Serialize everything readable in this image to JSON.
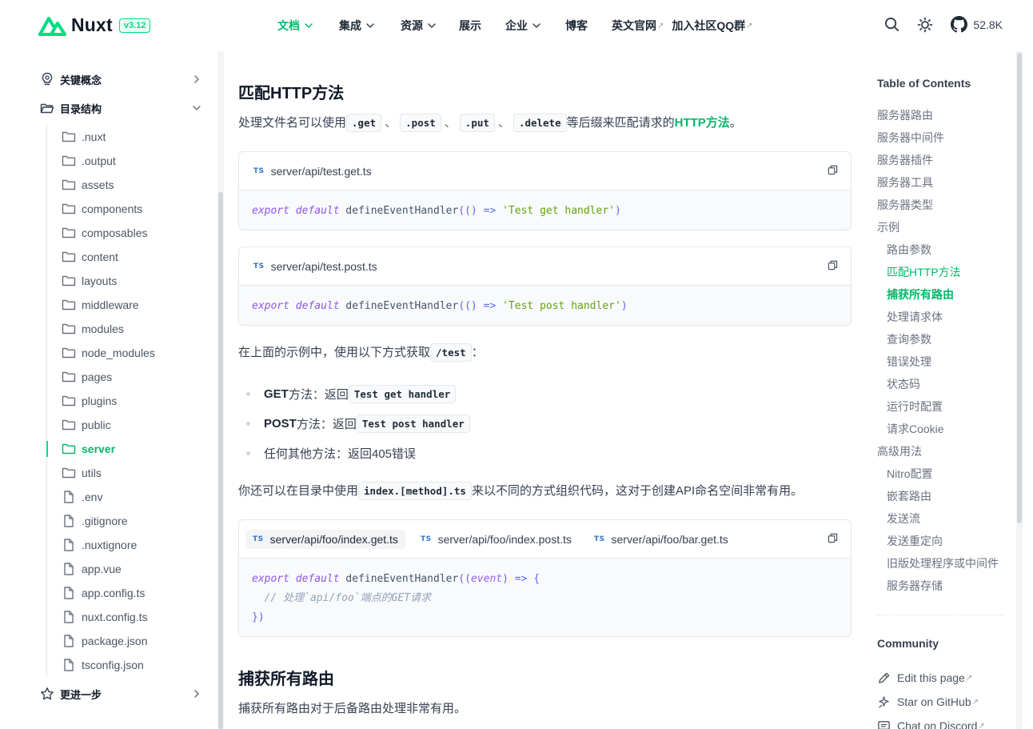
{
  "header": {
    "brand": "Nuxt",
    "version": "v3.12",
    "nav": [
      {
        "label": "文档",
        "dropdown": true,
        "active": true
      },
      {
        "label": "集成",
        "dropdown": true
      },
      {
        "label": "资源",
        "dropdown": true
      },
      {
        "label": "展示"
      },
      {
        "label": "企业",
        "dropdown": true
      },
      {
        "label": "博客"
      },
      {
        "label": "英文官网",
        "external": true
      },
      {
        "label": "加入社区QQ群",
        "external": true
      }
    ],
    "github_stars": "52.8K",
    "external_mark": "↗"
  },
  "sidebar": {
    "sections": [
      {
        "label": "关键概念",
        "icon": "lightbulb-icon",
        "expanded": false
      },
      {
        "label": "目录结构",
        "icon": "folder-open-icon",
        "expanded": true
      },
      {
        "label": "更进一步",
        "icon": "star-icon",
        "expanded": false
      }
    ],
    "tree": [
      {
        "label": ".nuxt",
        "type": "folder"
      },
      {
        "label": ".output",
        "type": "folder"
      },
      {
        "label": "assets",
        "type": "folder"
      },
      {
        "label": "components",
        "type": "folder"
      },
      {
        "label": "composables",
        "type": "folder"
      },
      {
        "label": "content",
        "type": "folder"
      },
      {
        "label": "layouts",
        "type": "folder"
      },
      {
        "label": "middleware",
        "type": "folder"
      },
      {
        "label": "modules",
        "type": "folder"
      },
      {
        "label": "node_modules",
        "type": "folder"
      },
      {
        "label": "pages",
        "type": "folder"
      },
      {
        "label": "plugins",
        "type": "folder"
      },
      {
        "label": "public",
        "type": "folder"
      },
      {
        "label": "server",
        "type": "folder",
        "active": true
      },
      {
        "label": "utils",
        "type": "folder"
      },
      {
        "label": ".env",
        "type": "file"
      },
      {
        "label": ".gitignore",
        "type": "file"
      },
      {
        "label": ".nuxtignore",
        "type": "file"
      },
      {
        "label": "app.vue",
        "type": "file"
      },
      {
        "label": "app.config.ts",
        "type": "file"
      },
      {
        "label": "nuxt.config.ts",
        "type": "file"
      },
      {
        "label": "package.json",
        "type": "file"
      },
      {
        "label": "tsconfig.json",
        "type": "file"
      }
    ]
  },
  "content": {
    "h_match": "匹配HTTP方法",
    "p_match": {
      "before": "处理文件名可以使用",
      "codes": [
        ".get",
        ".post",
        ".put",
        ".delete"
      ],
      "separator": "、",
      "after": "等后缀来匹配请求的",
      "link": "HTTP方法",
      "end": "。"
    },
    "block1": {
      "lang": "TS",
      "filename": "server/api/test.get.ts",
      "code": {
        "kw1": "export",
        "kw2": "default",
        "fn": "defineEventHandler",
        "open": "(() =>",
        "str": "'Test get handler'",
        "close": ")"
      }
    },
    "block2": {
      "lang": "TS",
      "filename": "server/api/test.post.ts",
      "code": {
        "kw1": "export",
        "kw2": "default",
        "fn": "defineEventHandler",
        "open": "(() =>",
        "str": "'Test post handler'",
        "close": ")"
      }
    },
    "p_example": {
      "before": "在上面的示例中，使用以下方式获取",
      "code": "/test",
      "after": "："
    },
    "bullets": [
      {
        "bold": "GET",
        "text": "方法：返回",
        "code": "Test get handler"
      },
      {
        "bold": "POST",
        "text": "方法：返回",
        "code": "Test post handler"
      },
      {
        "bold": "",
        "text": "任何其他方法：返回405错误",
        "code": ""
      }
    ],
    "p_method": {
      "before": "你还可以在目录中使用",
      "code": "index.[method].ts",
      "after": "来以不同的方式组织代码，这对于创建API命名空间非常有用。"
    },
    "block3": {
      "lang": "TS",
      "tabs": [
        "server/api/foo/index.get.ts",
        "server/api/foo/index.post.ts",
        "server/api/foo/bar.get.ts"
      ],
      "code": {
        "kw1": "export",
        "kw2": "default",
        "fn": "defineEventHandler",
        "open": "((",
        "param": "event",
        "arrow": ") => {",
        "comment": "// 处理`api/foo`端点的GET请求",
        "close": "})"
      }
    },
    "h_catch": "捕获所有路由",
    "p_catch": "捕获所有路由对于后备路由处理非常有用。"
  },
  "toc": {
    "title": "Table of Contents",
    "items": [
      {
        "label": "服务器路由",
        "level": 1
      },
      {
        "label": "服务器中间件",
        "level": 1
      },
      {
        "label": "服务器插件",
        "level": 1
      },
      {
        "label": "服务器工具",
        "level": 1
      },
      {
        "label": "服务器类型",
        "level": 1
      },
      {
        "label": "示例",
        "level": 1
      },
      {
        "label": "路由参数",
        "level": 2
      },
      {
        "label": "匹配HTTP方法",
        "level": 2,
        "active": true
      },
      {
        "label": "捕获所有路由",
        "level": 2,
        "active": true,
        "strong": true
      },
      {
        "label": "处理请求体",
        "level": 2
      },
      {
        "label": "查询参数",
        "level": 2
      },
      {
        "label": "错误处理",
        "level": 2
      },
      {
        "label": "状态码",
        "level": 2
      },
      {
        "label": "运行时配置",
        "level": 2
      },
      {
        "label": "请求Cookie",
        "level": 2
      },
      {
        "label": "高级用法",
        "level": 1
      },
      {
        "label": "Nitro配置",
        "level": 2
      },
      {
        "label": "嵌套路由",
        "level": 2
      },
      {
        "label": "发送流",
        "level": 2
      },
      {
        "label": "发送重定向",
        "level": 2
      },
      {
        "label": "旧版处理程序或中间件",
        "level": 2
      },
      {
        "label": "服务器存储",
        "level": 2
      }
    ]
  },
  "community": {
    "title": "Community",
    "items": [
      {
        "label": "Edit this page",
        "icon": "pencil-icon"
      },
      {
        "label": "Star on GitHub",
        "icon": "sparkle-icon"
      },
      {
        "label": "Chat on Discord",
        "icon": "chat-icon"
      }
    ]
  },
  "colors": {
    "accent": "#00dc82",
    "accent_text": "#00b96b"
  }
}
